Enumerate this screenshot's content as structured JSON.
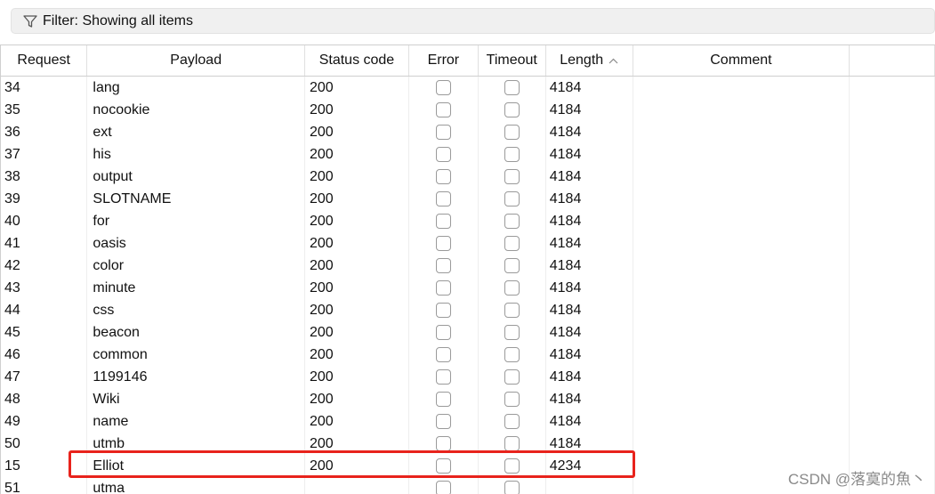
{
  "filter": {
    "label": "Filter: Showing all items"
  },
  "table": {
    "headers": {
      "request": "Request",
      "payload": "Payload",
      "status": "Status code",
      "error": "Error",
      "timeout": "Timeout",
      "length": "Length",
      "comment": "Comment"
    },
    "sorted_column": "length",
    "sort_direction": "ascending",
    "rows": [
      {
        "request": "34",
        "payload": "lang",
        "status": "200",
        "length": "4184"
      },
      {
        "request": "35",
        "payload": "nocookie",
        "status": "200",
        "length": "4184"
      },
      {
        "request": "36",
        "payload": "ext",
        "status": "200",
        "length": "4184"
      },
      {
        "request": "37",
        "payload": "his",
        "status": "200",
        "length": "4184"
      },
      {
        "request": "38",
        "payload": "output",
        "status": "200",
        "length": "4184"
      },
      {
        "request": "39",
        "payload": "SLOTNAME",
        "status": "200",
        "length": "4184"
      },
      {
        "request": "40",
        "payload": "for",
        "status": "200",
        "length": "4184"
      },
      {
        "request": "41",
        "payload": "oasis",
        "status": "200",
        "length": "4184"
      },
      {
        "request": "42",
        "payload": "color",
        "status": "200",
        "length": "4184"
      },
      {
        "request": "43",
        "payload": "minute",
        "status": "200",
        "length": "4184"
      },
      {
        "request": "44",
        "payload": "css",
        "status": "200",
        "length": "4184"
      },
      {
        "request": "45",
        "payload": "beacon",
        "status": "200",
        "length": "4184"
      },
      {
        "request": "46",
        "payload": "common",
        "status": "200",
        "length": "4184"
      },
      {
        "request": "47",
        "payload": "1199146",
        "status": "200",
        "length": "4184"
      },
      {
        "request": "48",
        "payload": "Wiki",
        "status": "200",
        "length": "4184"
      },
      {
        "request": "49",
        "payload": "name",
        "status": "200",
        "length": "4184"
      },
      {
        "request": "50",
        "payload": "utmb",
        "status": "200",
        "length": "4184"
      },
      {
        "request": "15",
        "payload": "Elliot",
        "status": "200",
        "length": "4234"
      },
      {
        "request": "51",
        "payload": "utma",
        "status": "",
        "length": ""
      }
    ],
    "highlighted_request": "15"
  },
  "watermark": "CSDN @落寞的魚丶",
  "colors": {
    "highlight_border": "#e8231c"
  }
}
